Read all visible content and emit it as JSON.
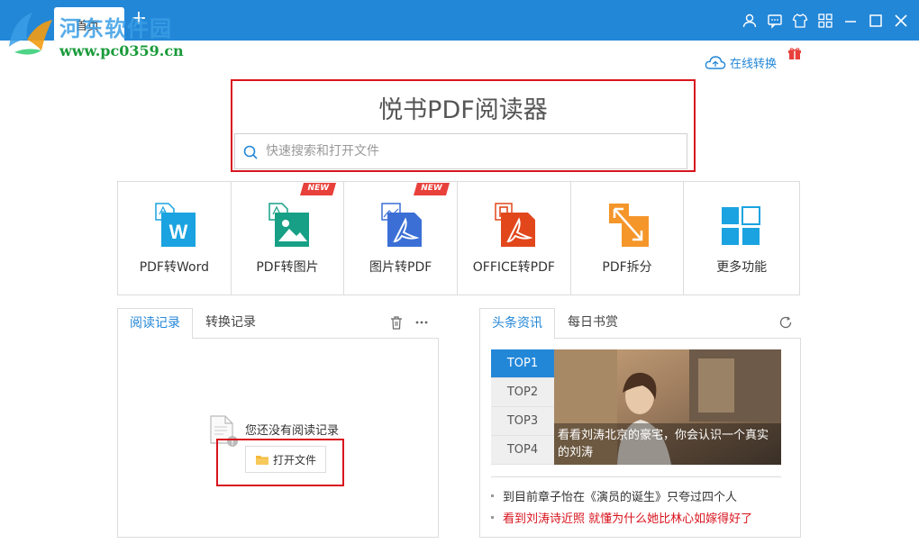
{
  "titlebar": {
    "tab_home": "首页",
    "tab_add": "+"
  },
  "watermark": {
    "title": "河东软件园",
    "url": "www.pc0359.cn"
  },
  "online_convert": "在线转换",
  "app_title": "悦书PDF阅读器",
  "search": {
    "placeholder": "快速搜索和打开文件",
    "value": ""
  },
  "tools": [
    {
      "label": "PDF转Word",
      "icon": "pdf-to-word-icon",
      "new": false
    },
    {
      "label": "PDF转图片",
      "icon": "pdf-to-image-icon",
      "new": true
    },
    {
      "label": "图片转PDF",
      "icon": "image-to-pdf-icon",
      "new": true
    },
    {
      "label": "OFFICE转PDF",
      "icon": "office-to-pdf-icon",
      "new": false
    },
    {
      "label": "PDF拆分",
      "icon": "pdf-split-icon",
      "new": false
    },
    {
      "label": "更多功能",
      "icon": "more-features-icon",
      "new": false
    }
  ],
  "new_badge": "NEW",
  "left_panel": {
    "tab_reading": "阅读记录",
    "tab_conversion": "转换记录",
    "empty_text": "您还没有阅读记录",
    "open_file": "打开文件"
  },
  "right_panel": {
    "tab_headlines": "头条资讯",
    "tab_daily": "每日书赏",
    "top_items": [
      "TOP1",
      "TOP2",
      "TOP3",
      "TOP4"
    ],
    "photo_caption": "看看刘涛北京的豪宅，你会认识一个真实的刘涛",
    "news": [
      {
        "text": "到目前章子怡在《演员的诞生》只夸过四个人",
        "color": "#333333"
      },
      {
        "text": "看到刘涛诗近照 就懂为什么她比林心如嫁得好了",
        "color": "#d9141e"
      }
    ]
  },
  "colors": {
    "accent": "#2387d8",
    "highlight_border": "#d9141e",
    "new_badge": "#e8403a"
  }
}
